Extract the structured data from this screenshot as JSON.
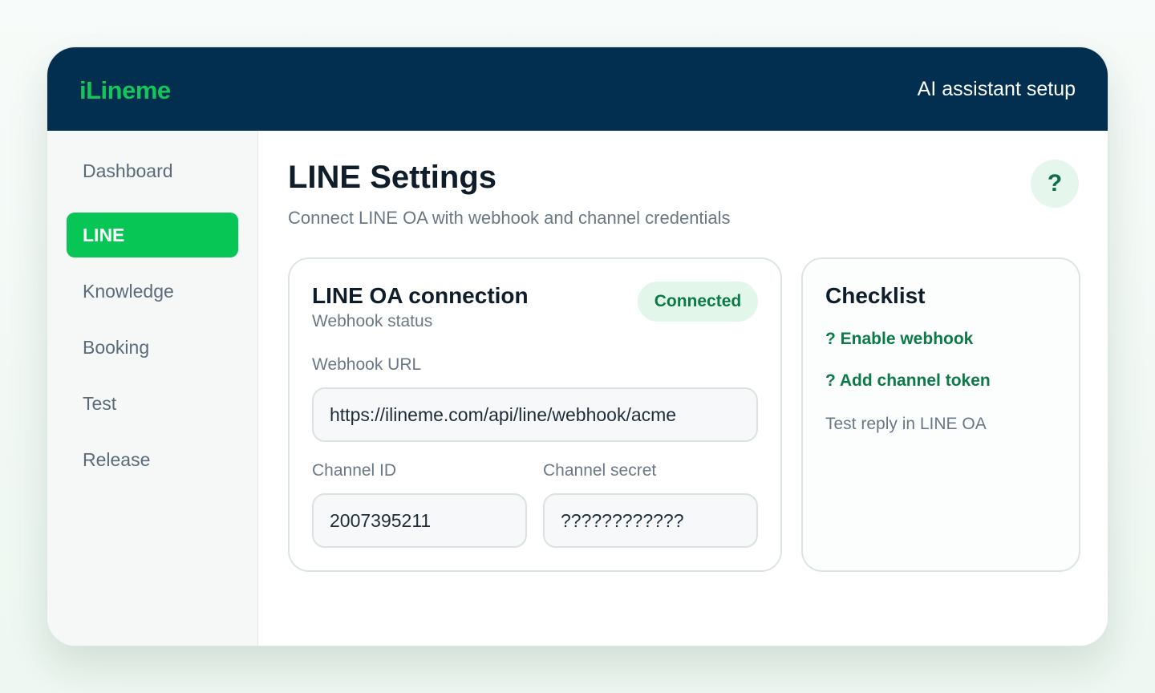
{
  "header": {
    "logo": "iLineme",
    "context_title": "AI assistant setup"
  },
  "sidebar": {
    "items": [
      {
        "label": "Dashboard",
        "active": false
      },
      {
        "label": "LINE",
        "active": true
      },
      {
        "label": "Knowledge",
        "active": false
      },
      {
        "label": "Booking",
        "active": false
      },
      {
        "label": "Test",
        "active": false
      },
      {
        "label": "Release",
        "active": false
      }
    ]
  },
  "page": {
    "title": "LINE Settings",
    "subtitle": "Connect LINE OA with webhook and channel credentials",
    "help_label": "?"
  },
  "connection": {
    "title": "LINE OA connection",
    "subtitle": "Webhook status",
    "status": "Connected",
    "webhook_label": "Webhook URL",
    "webhook_value": "https://ilineme.com/api/line/webhook/acme",
    "channel_id_label": "Channel ID",
    "channel_id_value": "2007395211",
    "channel_secret_label": "Channel secret",
    "channel_secret_value": "????????????"
  },
  "checklist": {
    "title": "Checklist",
    "items": [
      {
        "label": "? Enable webhook",
        "done": true
      },
      {
        "label": "? Add channel token",
        "done": true
      },
      {
        "label": "Test reply in LINE OA",
        "done": false
      }
    ]
  },
  "colors": {
    "brand_green": "#08c656",
    "header_navy": "#022f50",
    "success_text": "#0c7a47"
  }
}
